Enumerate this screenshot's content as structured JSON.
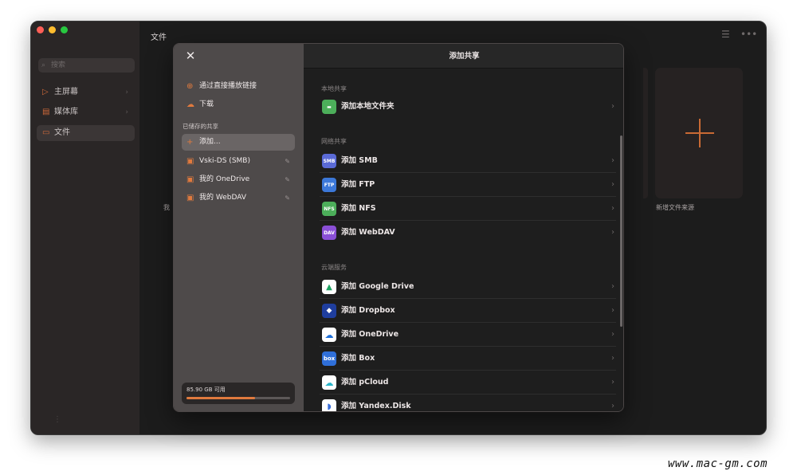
{
  "window": {
    "title": "文件",
    "traffic_colors": [
      "#ff5f57",
      "#febc2e",
      "#28c840"
    ]
  },
  "bg_sidebar": {
    "search_placeholder": "搜索",
    "items": [
      {
        "label": "主屏幕",
        "icon": "play-icon"
      },
      {
        "label": "媒体库",
        "icon": "library-icon"
      },
      {
        "label": "文件",
        "icon": "folder-icon"
      }
    ]
  },
  "bg_content": {
    "left_label": "我",
    "card_label": "新增文件来源"
  },
  "modal": {
    "title": "添加共享",
    "sidebar": {
      "top_items": [
        {
          "label": "通过直接播放链接",
          "icon": "globe-icon"
        },
        {
          "label": "下载",
          "icon": "cloud-download-icon"
        }
      ],
      "saved_header": "已储存的共享",
      "saved_items": [
        {
          "label": "添加...",
          "icon": "plus-icon"
        },
        {
          "label": "Vski-DS (SMB)",
          "icon": "drive-icon"
        },
        {
          "label": "我的 OneDrive",
          "icon": "drive-icon"
        },
        {
          "label": "我的 WebDAV",
          "icon": "drive-icon"
        }
      ],
      "storage_text": "85.90 GB 可用",
      "storage_used_fraction": 0.66
    },
    "sections": [
      {
        "header": "本地共享",
        "rows": [
          {
            "label": "添加本地文件夹",
            "icon": "folder-icon",
            "color": "#4cae5a",
            "tag": ""
          }
        ]
      },
      {
        "header": "网络共享",
        "rows": [
          {
            "label": "添加 SMB",
            "icon": "smb-icon",
            "color": "#5a6ad6",
            "tag": "SMB"
          },
          {
            "label": "添加 FTP",
            "icon": "ftp-icon",
            "color": "#3c78d8",
            "tag": "FTP"
          },
          {
            "label": "添加 NFS",
            "icon": "nfs-icon",
            "color": "#4cae5a",
            "tag": "NFS"
          },
          {
            "label": "添加 WebDAV",
            "icon": "webdav-icon",
            "color": "#8a4fd6",
            "tag": "DAV"
          }
        ]
      },
      {
        "header": "云端服务",
        "rows": [
          {
            "label": "添加 Google Drive",
            "icon": "google-drive-icon",
            "color": "#ffffff",
            "tag": ""
          },
          {
            "label": "添加 Dropbox",
            "icon": "dropbox-icon",
            "color": "#1f3e9e",
            "tag": ""
          },
          {
            "label": "添加 OneDrive",
            "icon": "onedrive-icon",
            "color": "#ffffff",
            "tag": ""
          },
          {
            "label": "添加 Box",
            "icon": "box-icon",
            "color": "#2f6fd9",
            "tag": "box"
          },
          {
            "label": "添加 pCloud",
            "icon": "pcloud-icon",
            "color": "#ffffff",
            "tag": ""
          },
          {
            "label": "添加 Yandex.Disk",
            "icon": "yandex-disk-icon",
            "color": "#ffffff",
            "tag": ""
          }
        ]
      }
    ]
  },
  "watermark": "www.mac-gm.com"
}
